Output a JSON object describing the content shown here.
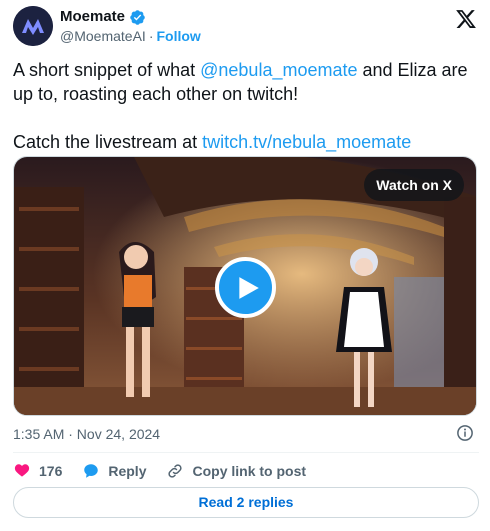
{
  "author": {
    "display_name": "Moemate",
    "handle": "@MoemateAI",
    "separator": "·",
    "follow_label": "Follow"
  },
  "tweet": {
    "line1_prefix": "A short snippet of what ",
    "line1_mention": "@nebula_moemate",
    "line1_suffix": " and Eliza are up to, roasting each other on twitch!",
    "line2_prefix": "Catch the livestream at ",
    "line2_link": "twitch.tv/nebula_moemate"
  },
  "media": {
    "watch_label": "Watch on X"
  },
  "meta": {
    "timestamp": "1:35 AM · Nov 24, 2024"
  },
  "actions": {
    "like_count": "176",
    "reply_label": "Reply",
    "copy_link_label": "Copy link to post"
  },
  "footer": {
    "read_replies_label": "Read 2 replies"
  },
  "colors": {
    "accent": "#1d9bf0",
    "like": "#f91880",
    "text": "#0f1419",
    "secondary": "#536471"
  },
  "icons": [
    "moemate-logo-icon",
    "verified-badge-icon",
    "x-logo-icon",
    "play-icon",
    "info-icon",
    "heart-icon",
    "reply-bubble-icon",
    "link-icon"
  ]
}
